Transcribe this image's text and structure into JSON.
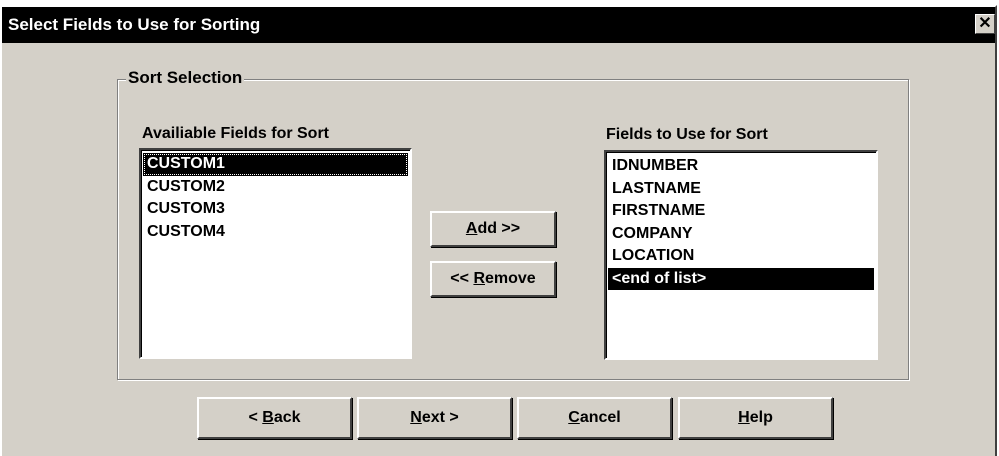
{
  "window": {
    "title": "Select Fields to Use for Sorting",
    "close_label": "✕"
  },
  "group": {
    "legend": "Sort Selection"
  },
  "available": {
    "label": "Availiable Fields for Sort",
    "items": [
      "CUSTOM1",
      "CUSTOM2",
      "CUSTOM3",
      "CUSTOM4"
    ],
    "selected_index": 0
  },
  "chosen": {
    "label": "Fields to Use for Sort",
    "items": [
      "IDNUMBER",
      "LASTNAME",
      "FIRSTNAME",
      "COMPANY",
      "LOCATION",
      "<end of list>"
    ],
    "selected_index": 5
  },
  "actions": {
    "add_prefix": "",
    "add_accel": "A",
    "add_rest": "dd >>",
    "remove_prefix": "<< ",
    "remove_accel": "R",
    "remove_rest": "emove"
  },
  "footer": {
    "back_prefix": "< ",
    "back_accel": "B",
    "back_rest": "ack",
    "next_prefix": "",
    "next_accel": "N",
    "next_rest": "ext >",
    "cancel_prefix": "",
    "cancel_accel": "C",
    "cancel_rest": "ancel",
    "help_prefix": "",
    "help_accel": "H",
    "help_rest": "elp"
  }
}
